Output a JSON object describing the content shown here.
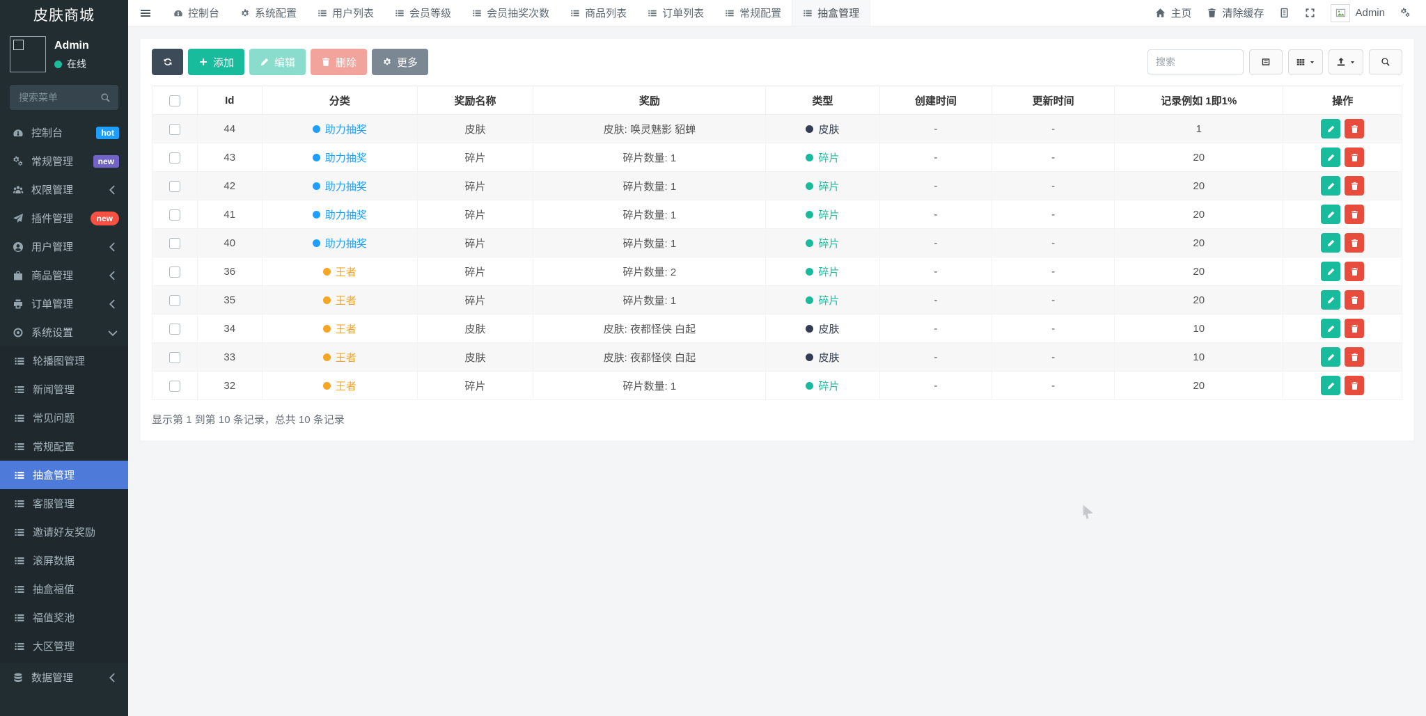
{
  "app": {
    "title": "皮肤商城"
  },
  "colors": {
    "sidebar_bg": "#222d32",
    "accent_green": "#18bc9c",
    "danger_red": "#e74c3c",
    "primary_dark": "#3d4a58",
    "more_gray": "#7b8793",
    "link_blue": "#1e9fff",
    "king_orange": "#f6a623",
    "skin_dark": "#323c52",
    "active_menu_blue": "#4e7bd9"
  },
  "topnav": {
    "tabs": [
      {
        "label": "控制台",
        "icon": "dashboard",
        "active": false
      },
      {
        "label": "系统配置",
        "icon": "gear",
        "active": false
      },
      {
        "label": "用户列表",
        "icon": "list",
        "active": false
      },
      {
        "label": "会员等级",
        "icon": "list",
        "active": false
      },
      {
        "label": "会员抽奖次数",
        "icon": "list",
        "active": false
      },
      {
        "label": "商品列表",
        "icon": "list",
        "active": false
      },
      {
        "label": "订单列表",
        "icon": "list",
        "active": false
      },
      {
        "label": "常规配置",
        "icon": "list",
        "active": false
      },
      {
        "label": "抽盒管理",
        "icon": "list",
        "active": true
      }
    ],
    "right": {
      "home": "主页",
      "clear_cache": "清除缓存",
      "user": "Admin"
    }
  },
  "sidebar": {
    "user": {
      "name": "Admin",
      "status": "在线"
    },
    "search_placeholder": "搜索菜单",
    "menu": [
      {
        "label": "控制台",
        "icon": "dashboard",
        "level": "top",
        "badge": "hot",
        "badge_color": "#1e9fff",
        "badge_pill": false
      },
      {
        "label": "常规管理",
        "icon": "gears",
        "level": "top",
        "badge": "new",
        "badge_color": "#7163c8",
        "badge_pill": false
      },
      {
        "label": "权限管理",
        "icon": "users",
        "level": "top",
        "chevron": "left"
      },
      {
        "label": "插件管理",
        "icon": "plane",
        "level": "top",
        "badge": "new",
        "badge_color": "#f65142",
        "badge_pill": true
      },
      {
        "label": "用户管理",
        "icon": "user",
        "level": "top",
        "chevron": "left"
      },
      {
        "label": "商品管理",
        "icon": "bag",
        "level": "top",
        "chevron": "left"
      },
      {
        "label": "订单管理",
        "icon": "printer",
        "level": "top",
        "chevron": "left"
      },
      {
        "label": "系统设置",
        "icon": "target",
        "level": "top",
        "chevron": "down",
        "open": true
      },
      {
        "label": "轮播图管理",
        "icon": "list",
        "level": "sub"
      },
      {
        "label": "新闻管理",
        "icon": "list",
        "level": "sub"
      },
      {
        "label": "常见问题",
        "icon": "list",
        "level": "sub"
      },
      {
        "label": "常规配置",
        "icon": "list",
        "level": "sub"
      },
      {
        "label": "抽盒管理",
        "icon": "list",
        "level": "sub",
        "active": true
      },
      {
        "label": "客服管理",
        "icon": "list",
        "level": "sub"
      },
      {
        "label": "邀请好友奖励",
        "icon": "list",
        "level": "sub"
      },
      {
        "label": "滚屏数据",
        "icon": "list",
        "level": "sub"
      },
      {
        "label": "抽盒福值",
        "icon": "list",
        "level": "sub"
      },
      {
        "label": "福值奖池",
        "icon": "list",
        "level": "sub"
      },
      {
        "label": "大区管理",
        "icon": "list",
        "level": "sub"
      },
      {
        "label": "数据管理",
        "icon": "database",
        "level": "top",
        "chevron": "left"
      }
    ]
  },
  "toolbar": {
    "add_label": "添加",
    "edit_label": "编辑",
    "delete_label": "删除",
    "more_label": "更多",
    "search_placeholder": "搜索"
  },
  "table": {
    "headers": [
      "Id",
      "分类",
      "奖励名称",
      "奖励",
      "类型",
      "创建时间",
      "更新时间",
      "记录例如 1即1%",
      "操作"
    ],
    "rows": [
      {
        "id": "44",
        "category": "助力抽奖",
        "category_color": "#1e9fff",
        "name": "皮肤",
        "prize": "皮肤: 唤灵魅影 貂蝉",
        "type": "皮肤",
        "type_color": "#323c52",
        "created": "-",
        "updated": "-",
        "rate": "1"
      },
      {
        "id": "43",
        "category": "助力抽奖",
        "category_color": "#1e9fff",
        "name": "碎片",
        "prize": "碎片数量: 1",
        "type": "碎片",
        "type_color": "#18bc9c",
        "created": "-",
        "updated": "-",
        "rate": "20"
      },
      {
        "id": "42",
        "category": "助力抽奖",
        "category_color": "#1e9fff",
        "name": "碎片",
        "prize": "碎片数量: 1",
        "type": "碎片",
        "type_color": "#18bc9c",
        "created": "-",
        "updated": "-",
        "rate": "20"
      },
      {
        "id": "41",
        "category": "助力抽奖",
        "category_color": "#1e9fff",
        "name": "碎片",
        "prize": "碎片数量: 1",
        "type": "碎片",
        "type_color": "#18bc9c",
        "created": "-",
        "updated": "-",
        "rate": "20"
      },
      {
        "id": "40",
        "category": "助力抽奖",
        "category_color": "#1e9fff",
        "name": "碎片",
        "prize": "碎片数量: 1",
        "type": "碎片",
        "type_color": "#18bc9c",
        "created": "-",
        "updated": "-",
        "rate": "20"
      },
      {
        "id": "36",
        "category": "王者",
        "category_color": "#f6a623",
        "name": "碎片",
        "prize": "碎片数量: 2",
        "type": "碎片",
        "type_color": "#18bc9c",
        "created": "-",
        "updated": "-",
        "rate": "20"
      },
      {
        "id": "35",
        "category": "王者",
        "category_color": "#f6a623",
        "name": "碎片",
        "prize": "碎片数量: 1",
        "type": "碎片",
        "type_color": "#18bc9c",
        "created": "-",
        "updated": "-",
        "rate": "20"
      },
      {
        "id": "34",
        "category": "王者",
        "category_color": "#f6a623",
        "name": "皮肤",
        "prize": "皮肤: 夜都怪侠 白起",
        "type": "皮肤",
        "type_color": "#323c52",
        "created": "-",
        "updated": "-",
        "rate": "10"
      },
      {
        "id": "33",
        "category": "王者",
        "category_color": "#f6a623",
        "name": "皮肤",
        "prize": "皮肤: 夜都怪侠 白起",
        "type": "皮肤",
        "type_color": "#323c52",
        "created": "-",
        "updated": "-",
        "rate": "10"
      },
      {
        "id": "32",
        "category": "王者",
        "category_color": "#f6a623",
        "name": "碎片",
        "prize": "碎片数量: 1",
        "type": "碎片",
        "type_color": "#18bc9c",
        "created": "-",
        "updated": "-",
        "rate": "20"
      }
    ],
    "summary": "显示第 1 到第 10 条记录，总共 10 条记录"
  }
}
